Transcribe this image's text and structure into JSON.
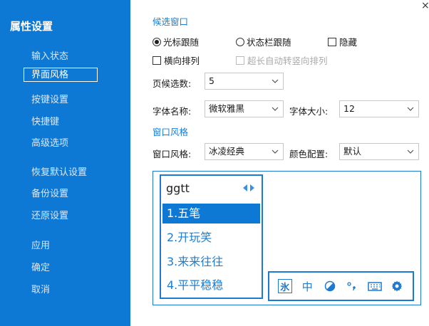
{
  "sidebar": {
    "title": "属性设置",
    "items": [
      {
        "label": "输入状态"
      },
      {
        "label": "界面风格"
      },
      {
        "label": "按键设置"
      },
      {
        "label": "快捷键"
      },
      {
        "label": "高级选项"
      },
      {
        "label": "恢复默认设置"
      },
      {
        "label": "备份设置"
      },
      {
        "label": "还原设置"
      },
      {
        "label": "应用"
      },
      {
        "label": "确定"
      },
      {
        "label": "取消"
      }
    ],
    "active_index": 1
  },
  "window": {
    "close_symbol": "×"
  },
  "candidate_window_section": {
    "title": "候选窗口",
    "follow_cursor": "光标跟随",
    "follow_statusbar": "状态栏跟随",
    "hide": "隐藏",
    "horizontal": "横向排列",
    "auto_vertical": "超长自动转竖向排列",
    "selected_mode": "follow_cursor",
    "page_count_label": "页候选数:",
    "page_count_value": "5",
    "font_name_label": "字体名称:",
    "font_name_value": "微软雅黑",
    "font_size_label": "字体大小:",
    "font_size_value": "12"
  },
  "style_section": {
    "title": "窗口风格",
    "style_label": "窗口风格:",
    "style_value": "冰凌经典",
    "color_label": "颜色配置:",
    "color_value": "默认"
  },
  "preview": {
    "input_code": "ggtt",
    "candidates": [
      "1.五笔",
      "2.开玩笑",
      "3.来来往往",
      "4.平平稳稳"
    ],
    "selected_index": 0,
    "toolbar_mode_char": "氷",
    "toolbar_width_char": "中",
    "toolbar_icons": [
      "mode-icon",
      "fullwidth-icon",
      "skin-icon",
      "punctuation-icon",
      "keyboard-icon",
      "gear-icon"
    ]
  },
  "colors": {
    "accent": "#0e78d5",
    "border": "#1d7ad0"
  }
}
